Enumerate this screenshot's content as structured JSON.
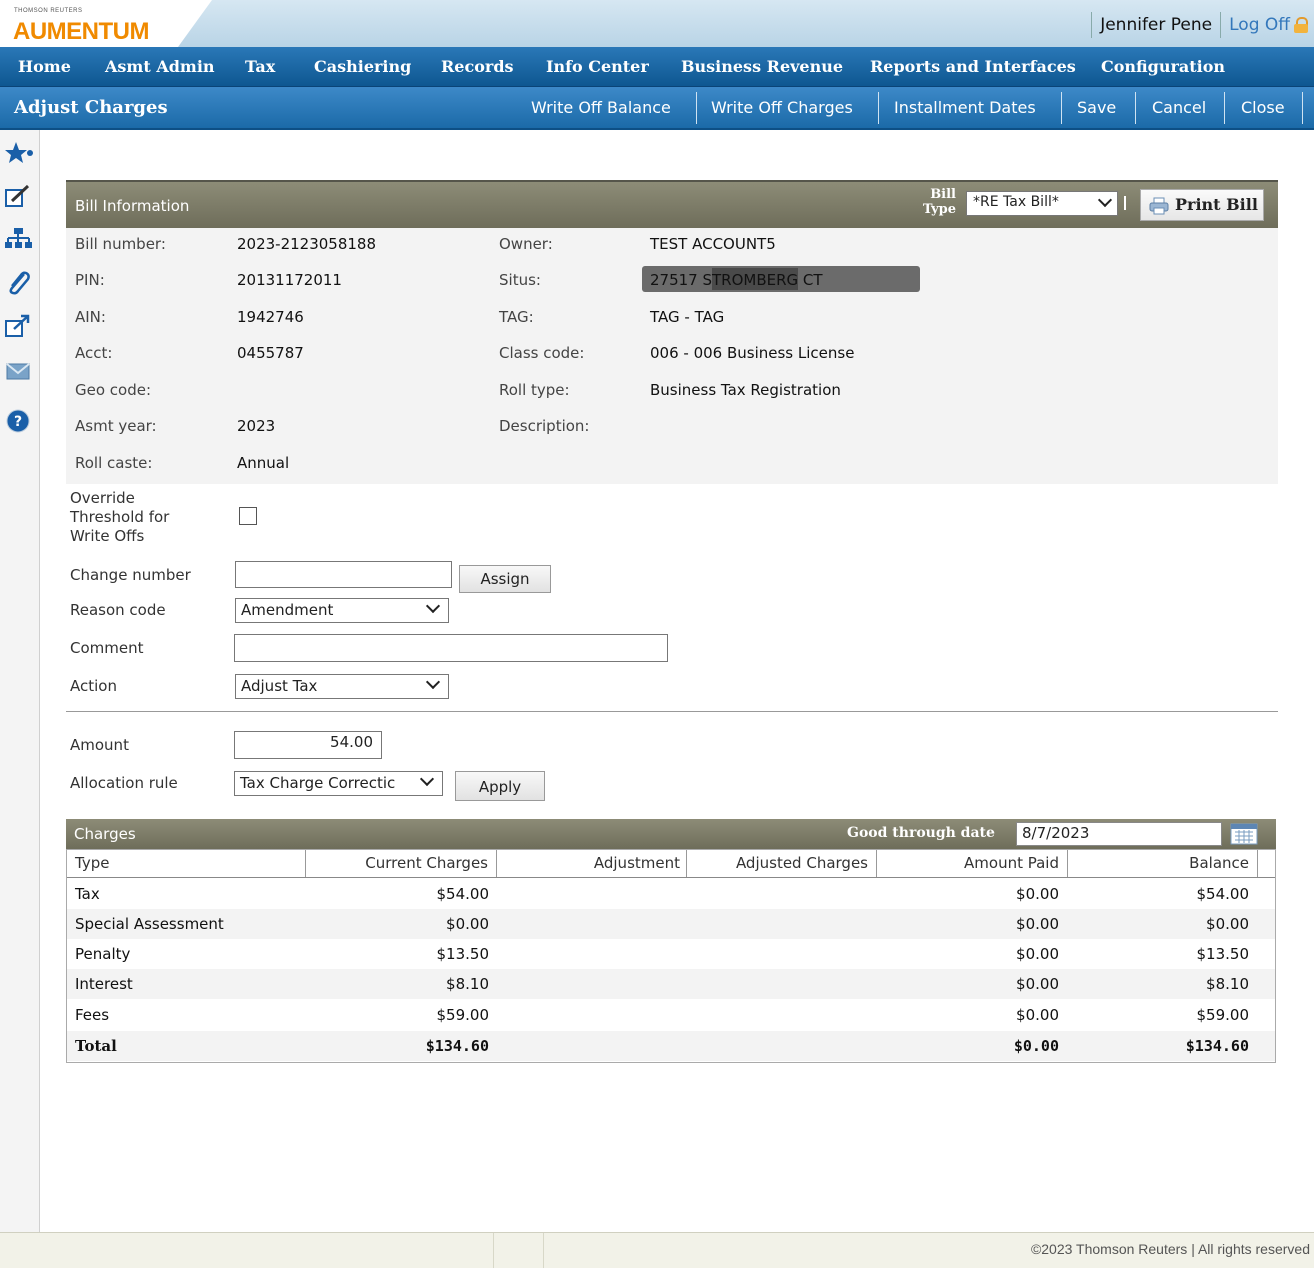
{
  "brand": {
    "company": "THOMSON REUTERS",
    "product": "AUMENTUM"
  },
  "user": {
    "name": "Jennifer Pene",
    "logoff": "Log Off"
  },
  "mainnav": [
    "Home",
    "Asmt Admin",
    "Tax",
    "Cashiering",
    "Records",
    "Info Center",
    "Business Revenue",
    "Reports and Interfaces",
    "Configuration"
  ],
  "subbar": {
    "title": "Adjust Charges",
    "buttons": [
      "Write Off Balance",
      "Write Off Charges",
      "Installment Dates",
      "Save",
      "Cancel",
      "Close"
    ]
  },
  "bill_info": {
    "title": "Bill Information",
    "bill_type_label_1": "Bill",
    "bill_type_label_2": "Type",
    "bill_type_value": "*RE Tax Bill*",
    "print_label": "Print Bill",
    "left": [
      {
        "label": "Bill number:",
        "value": "2023-2123058188"
      },
      {
        "label": "PIN:",
        "value": "20131172011"
      },
      {
        "label": "AIN:",
        "value": "1942746"
      },
      {
        "label": "Acct:",
        "value": "0455787"
      },
      {
        "label": "Geo code:",
        "value": ""
      },
      {
        "label": "Asmt year:",
        "value": "2023"
      },
      {
        "label": "Roll caste:",
        "value": "Annual"
      }
    ],
    "right": [
      {
        "label": "Owner:",
        "value": "TEST ACCOUNT5"
      },
      {
        "label": "Situs:",
        "value": "27517 STROMBERG CT"
      },
      {
        "label": "TAG:",
        "value": "TAG - TAG"
      },
      {
        "label": "Class code:",
        "value": "006 - 006 Business License"
      },
      {
        "label": "Roll type:",
        "value": "Business Tax Registration"
      },
      {
        "label": "Description:",
        "value": ""
      }
    ]
  },
  "form": {
    "override_label": [
      "Override",
      "Threshold for",
      "Write Offs"
    ],
    "override_checked": false,
    "change_number_label": "Change number",
    "change_number_value": "",
    "assign_label": "Assign",
    "reason_code_label": "Reason code",
    "reason_code_value": "Amendment",
    "comment_label": "Comment",
    "comment_value": "",
    "action_label": "Action",
    "action_value": "Adjust Tax",
    "amount_label": "Amount",
    "amount_value": "54.00",
    "allocation_label": "Allocation rule",
    "allocation_value": "Tax Charge Correctic",
    "apply_label": "Apply"
  },
  "charges": {
    "title": "Charges",
    "good_through_label": "Good through date",
    "good_through_value": "8/7/2023",
    "columns": [
      "Type",
      "Current Charges",
      "Adjustment",
      "Adjusted Charges",
      "Amount Paid",
      "Balance"
    ],
    "rows": [
      {
        "type": "Tax",
        "current": "$54.00",
        "adjustment": "",
        "adjusted": "",
        "paid": "$0.00",
        "balance": "$54.00"
      },
      {
        "type": "Special Assessment",
        "current": "$0.00",
        "adjustment": "",
        "adjusted": "",
        "paid": "$0.00",
        "balance": "$0.00"
      },
      {
        "type": "Penalty",
        "current": "$13.50",
        "adjustment": "",
        "adjusted": "",
        "paid": "$0.00",
        "balance": "$13.50"
      },
      {
        "type": "Interest",
        "current": "$8.10",
        "adjustment": "",
        "adjusted": "",
        "paid": "$0.00",
        "balance": "$8.10"
      },
      {
        "type": "Fees",
        "current": "$59.00",
        "adjustment": "",
        "adjusted": "",
        "paid": "$0.00",
        "balance": "$59.00"
      }
    ],
    "total": {
      "type": "Total",
      "current": "$134.60",
      "adjustment": "",
      "adjusted": "",
      "paid": "$0.00",
      "balance": "$134.60"
    }
  },
  "footer": {
    "copyright": "©2023 Thomson Reuters | All rights reserved"
  },
  "colors": {
    "nav": "#0e5791",
    "panel_header": "#7d7c68",
    "brand": "#f08a00"
  }
}
